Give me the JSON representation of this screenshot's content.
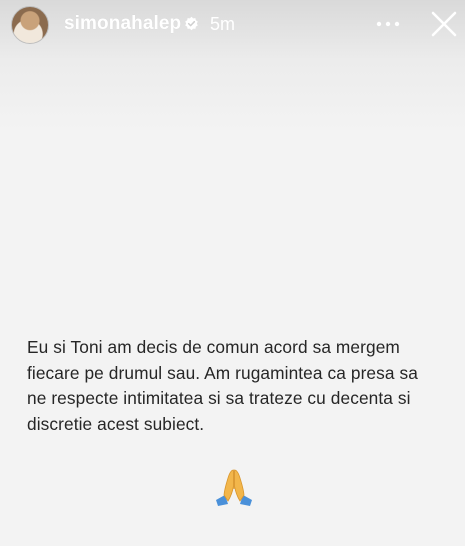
{
  "story": {
    "username": "simonahalep",
    "time": "5m",
    "verified": true,
    "icons": {
      "verified": "verified-badge-icon",
      "more": "more-options-icon",
      "close": "close-icon",
      "emoji": "folded-hands-emoji"
    },
    "colors": {
      "header_text": "#ffffff",
      "body_text": "#262626",
      "background": "#f3f3f3",
      "emoji_skin": "#f2b64b",
      "emoji_sleeve": "#4a90d9"
    },
    "message": "Eu si Toni am decis de comun acord sa mergem fiecare pe drumul sau. Am rugamintea ca presa sa ne respecte intimitatea si sa trateze cu decenta si discretie acest subiect."
  }
}
